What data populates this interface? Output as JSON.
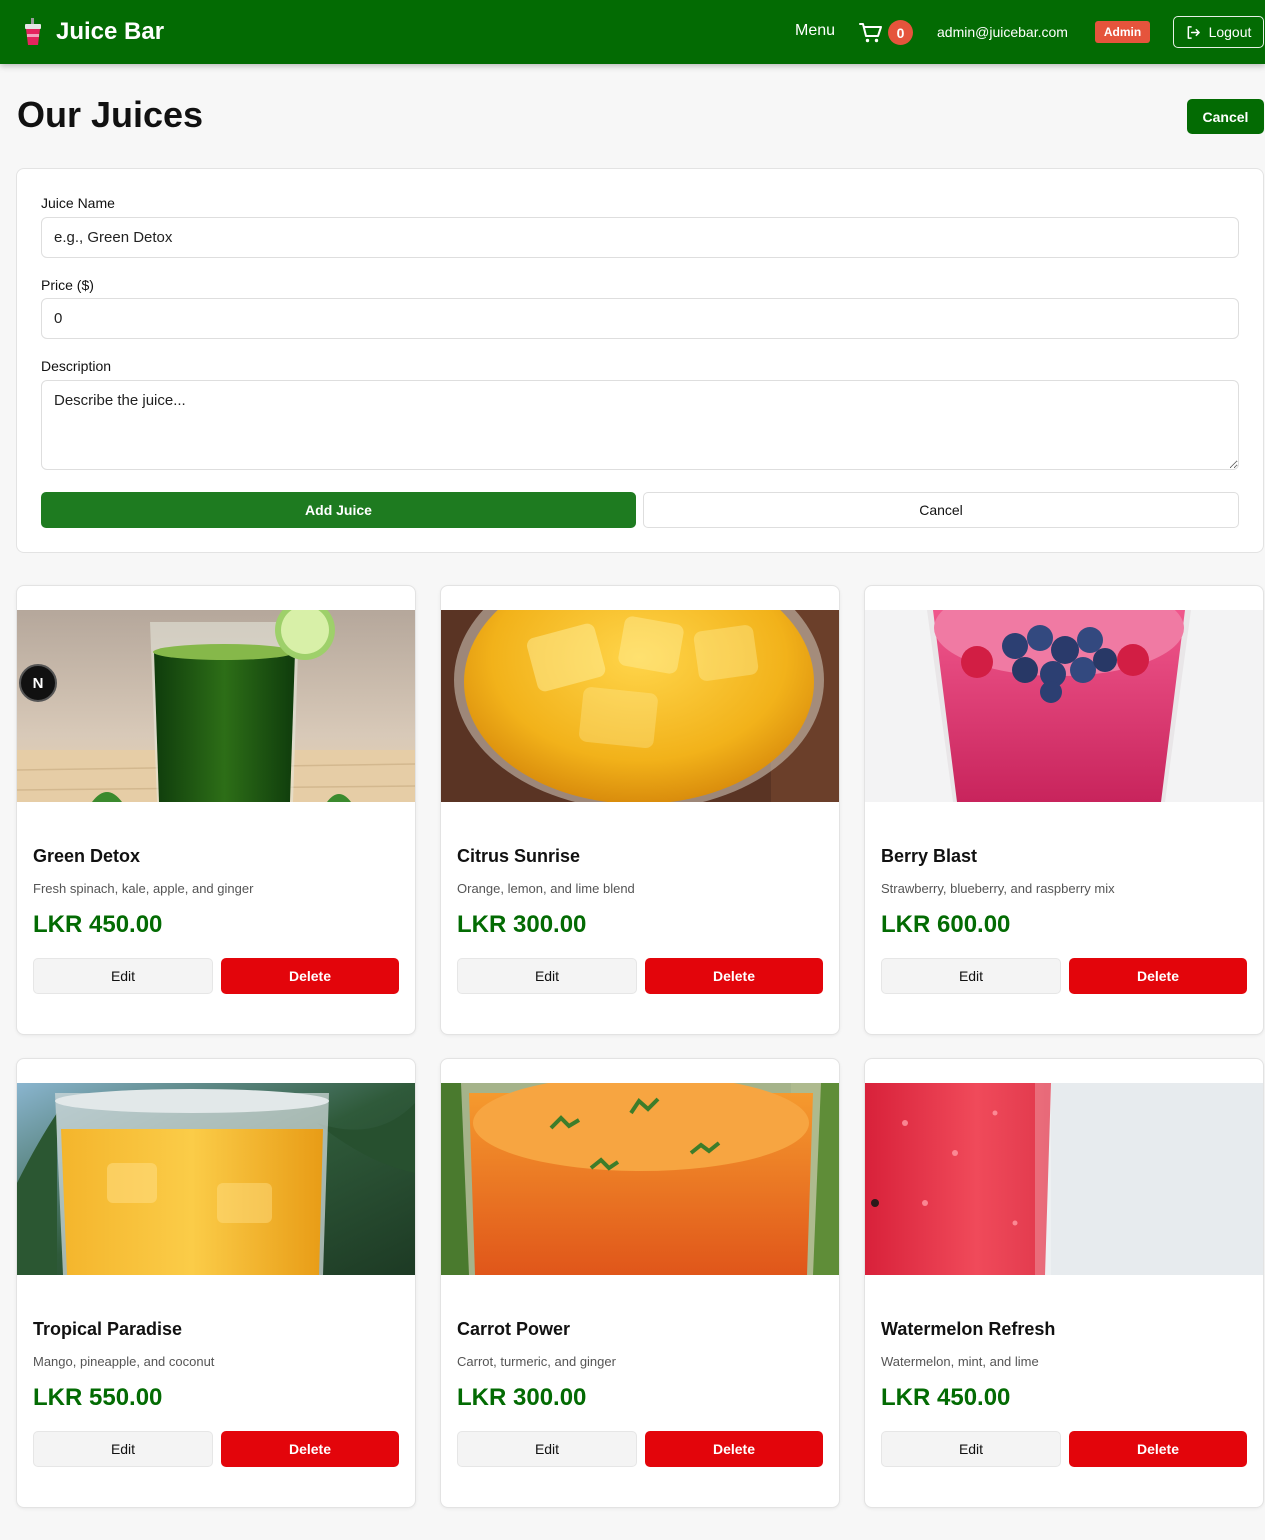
{
  "nav": {
    "brand": "Juice Bar",
    "menu_label": "Menu",
    "cart_count": "0",
    "email": "admin@juicebar.com",
    "role_badge": "Admin",
    "logout_label": "Logout",
    "brand_color": "#036b03",
    "badge_color": "#e5543c"
  },
  "header": {
    "title": "Our Juices",
    "cancel_label": "Cancel"
  },
  "form": {
    "name_label": "Juice Name",
    "name_placeholder": "e.g., Green Detox",
    "price_label": "Price ($)",
    "price_value": "0",
    "description_label": "Description",
    "description_placeholder": "Describe the juice...",
    "submit_label": "Add Juice",
    "cancel_label": "Cancel"
  },
  "juices": [
    {
      "name": "Green Detox",
      "description": "Fresh spinach, kale, apple, and ginger",
      "price": "LKR 450.00",
      "edit_label": "Edit",
      "delete_label": "Delete"
    },
    {
      "name": "Citrus Sunrise",
      "description": "Orange, lemon, and lime blend",
      "price": "LKR 300.00",
      "edit_label": "Edit",
      "delete_label": "Delete"
    },
    {
      "name": "Berry Blast",
      "description": "Strawberry, blueberry, and raspberry mix",
      "price": "LKR 600.00",
      "edit_label": "Edit",
      "delete_label": "Delete"
    },
    {
      "name": "Tropical Paradise",
      "description": "Mango, pineapple, and coconut",
      "price": "LKR 550.00",
      "edit_label": "Edit",
      "delete_label": "Delete"
    },
    {
      "name": "Carrot Power",
      "description": "Carrot, turmeric, and ginger",
      "price": "LKR 300.00",
      "edit_label": "Edit",
      "delete_label": "Delete"
    },
    {
      "name": "Watermelon Refresh",
      "description": "Watermelon, mint, and lime",
      "price": "LKR 450.00",
      "edit_label": "Edit",
      "delete_label": "Delete"
    }
  ],
  "dev_badge": "N",
  "colors": {
    "price": "#036b03",
    "delete": "#e3050b",
    "add_button": "#1e7b20"
  }
}
